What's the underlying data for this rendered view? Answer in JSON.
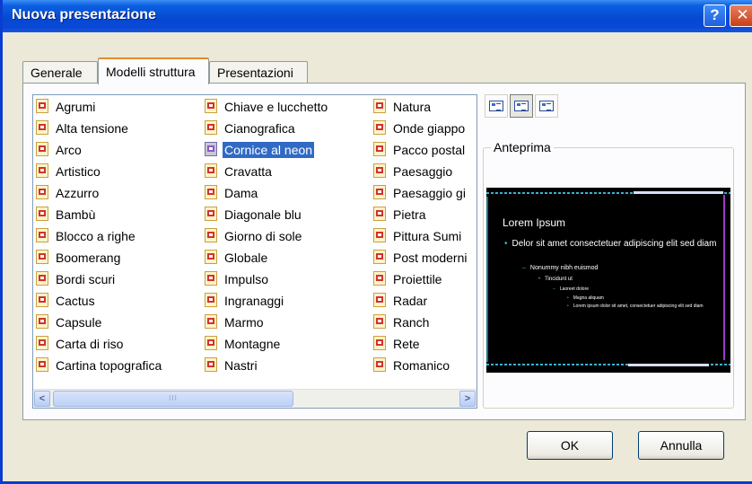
{
  "window": {
    "title": "Nuova presentazione"
  },
  "titlebar": {
    "help_glyph": "?",
    "close_glyph": "✕"
  },
  "tabs": [
    {
      "label": "Generale"
    },
    {
      "label": "Modelli struttura"
    },
    {
      "label": "Presentazioni"
    }
  ],
  "templates": {
    "col1": [
      "Agrumi",
      "Alta tensione",
      "Arco",
      "Artistico",
      "Azzurro",
      "Bambù",
      "Blocco a righe",
      "Boomerang",
      "Bordi scuri",
      "Cactus",
      "Capsule",
      "Carta di riso",
      "Cartina topografica"
    ],
    "col2": [
      "Chiave e lucchetto",
      "Cianografica",
      "Cornice al neon",
      "Cravatta",
      "Dama",
      "Diagonale blu",
      "Giorno di sole",
      "Globale",
      "Impulso",
      "Ingranaggi",
      "Marmo",
      "Montagne",
      "Nastri"
    ],
    "col3": [
      "Natura",
      "Onde giappo",
      "Pacco postal",
      "Paesaggio",
      "Paesaggio gi",
      "Pietra",
      "Pittura Sumi",
      "Post moderni",
      "Proiettile",
      "Radar",
      "Ranch",
      "Rete",
      "Romanico"
    ],
    "selected": "Cornice al neon"
  },
  "scrollbar": {
    "left_glyph": "<",
    "right_glyph": ">",
    "thumb_grip": "III"
  },
  "preview": {
    "label": "Anteprima",
    "title": "Lorem Ipsum",
    "bullet1": "Delor sit amet consectetuer adipiscing elit sed diam",
    "bullet2": "Nonummy nibh euismod",
    "bullet3": "Tincidunt ut",
    "bullet4": "Laoreet dolore",
    "bullet5": "Magna aliquam",
    "bullet6": "Lorem ipsum dolor sit amet, consectetuer adipiscing elit sed diam"
  },
  "buttons": {
    "ok": "OK",
    "cancel": "Annulla"
  },
  "colors": {
    "titlebar": "#0548d0",
    "selection": "#316ac5",
    "dialog_bg": "#ece9d8"
  }
}
